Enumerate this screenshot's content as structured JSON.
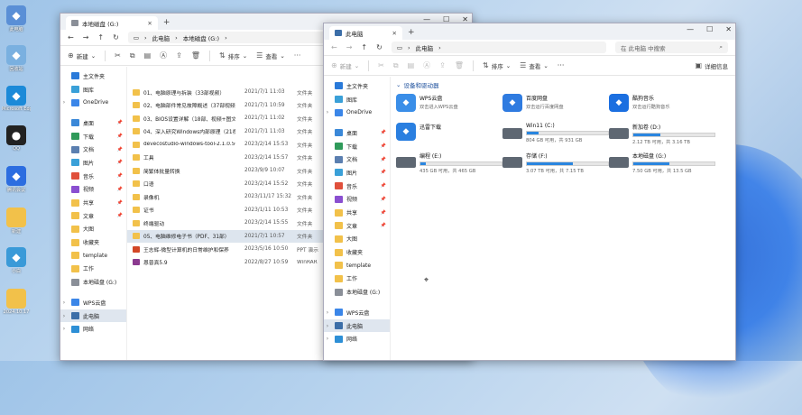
{
  "desktop": {
    "icons": [
      {
        "label": "此电脑",
        "icon": "pc-icon",
        "color": "#5a8fd6"
      },
      {
        "label": "回收站",
        "icon": "recycle-bin-icon",
        "color": "#7ab0e0"
      },
      {
        "label": "Microsoft Edge",
        "icon": "edge-icon",
        "color": "#1c8ad8"
      },
      {
        "label": "QQ",
        "icon": "qq-icon",
        "color": "#222222"
      },
      {
        "label": "腾讯会议",
        "icon": "meeting-icon",
        "color": "#2c6de0"
      },
      {
        "label": "新建",
        "icon": "folder-icon",
        "color": "#f2c14a"
      },
      {
        "label": "小白",
        "icon": "app-icon",
        "color": "#3a9ad8"
      },
      {
        "label": "2024.10.17",
        "icon": "folder-icon",
        "color": "#f2c14a"
      }
    ]
  },
  "left_window": {
    "tab_title": "本地磁盘 (G:)",
    "breadcrumb": [
      "此电脑",
      "本地磁盘 (G:)"
    ],
    "toolbar": {
      "new": "新建",
      "sort": "排序",
      "view": "查看"
    },
    "nav": [
      {
        "label": "主文件夹",
        "icon": "home-icon",
        "chev": "",
        "pin": false,
        "sel": false
      },
      {
        "label": "图库",
        "icon": "gallery-icon",
        "chev": "",
        "pin": false,
        "sel": false
      },
      {
        "label": "OneDrive",
        "icon": "cloud-icon",
        "chev": "›",
        "pin": false,
        "sel": false
      },
      {
        "label": "",
        "icon": "",
        "chev": "",
        "pin": false,
        "sel": false,
        "gap": true
      },
      {
        "label": "桌面",
        "icon": "desktop-icon",
        "chev": "",
        "pin": true,
        "sel": false
      },
      {
        "label": "下载",
        "icon": "download-icon",
        "chev": "",
        "pin": true,
        "sel": false
      },
      {
        "label": "文档",
        "icon": "document-icon",
        "chev": "",
        "pin": true,
        "sel": false
      },
      {
        "label": "图片",
        "icon": "picture-icon",
        "chev": "",
        "pin": true,
        "sel": false
      },
      {
        "label": "音乐",
        "icon": "music-icon",
        "chev": "",
        "pin": true,
        "sel": false
      },
      {
        "label": "视频",
        "icon": "video-icon",
        "chev": "",
        "pin": true,
        "sel": false
      },
      {
        "label": "共享",
        "icon": "folder-icon",
        "chev": "",
        "pin": true,
        "sel": false
      },
      {
        "label": "文章",
        "icon": "folder-icon",
        "chev": "",
        "pin": true,
        "sel": false
      },
      {
        "label": "大图",
        "icon": "folder-icon",
        "chev": "",
        "pin": false,
        "sel": false
      },
      {
        "label": "收藏夹",
        "icon": "folder-icon",
        "chev": "",
        "pin": false,
        "sel": false
      },
      {
        "label": "template",
        "icon": "folder-icon",
        "chev": "",
        "pin": false,
        "sel": false
      },
      {
        "label": "工作",
        "icon": "folder-icon",
        "chev": "",
        "pin": false,
        "sel": false
      },
      {
        "label": "本地磁盘 (G:)",
        "icon": "drive-icon",
        "chev": "",
        "pin": false,
        "sel": false
      },
      {
        "label": "",
        "icon": "",
        "chev": "",
        "pin": false,
        "sel": false,
        "gap": true
      },
      {
        "label": "WPS云盘",
        "icon": "cloud-icon",
        "chev": "›",
        "pin": false,
        "sel": false
      },
      {
        "label": "此电脑",
        "icon": "pc-icon",
        "chev": "›",
        "pin": false,
        "sel": true
      },
      {
        "label": "网络",
        "icon": "network-icon",
        "chev": "›",
        "pin": false,
        "sel": false
      }
    ],
    "files": [
      {
        "name": "01、电脑原理与拆装（33部视频）",
        "date": "2021/7/1 11:03",
        "type": "文件夹",
        "kind": "folder",
        "sel": false
      },
      {
        "name": "02、电脑部件常见故障概述（37部视频）",
        "date": "2021/7/1 10:59",
        "type": "文件夹",
        "kind": "folder",
        "sel": false
      },
      {
        "name": "03、BIOS设置详解（18部、视频+图文）",
        "date": "2021/7/1 11:02",
        "type": "文件夹",
        "kind": "folder",
        "sel": false
      },
      {
        "name": "04、深入研究Windows内部原理（21视...",
        "date": "2021/7/1 11:03",
        "type": "文件夹",
        "kind": "folder",
        "sel": false
      },
      {
        "name": "devecostudio-windows-tool-2.1.0.501",
        "date": "2023/2/14 15:53",
        "type": "文件夹",
        "kind": "folder",
        "sel": false
      },
      {
        "name": "工具",
        "date": "2023/2/14 15:57",
        "type": "文件夹",
        "kind": "folder",
        "sel": false
      },
      {
        "name": "简繁体批量转换",
        "date": "2023/9/9 10:07",
        "type": "文件夹",
        "kind": "folder",
        "sel": false
      },
      {
        "name": "口语",
        "date": "2023/2/14 15:52",
        "type": "文件夹",
        "kind": "folder",
        "sel": false
      },
      {
        "name": "录像机",
        "date": "2023/11/17 15:32",
        "type": "文件夹",
        "kind": "folder",
        "sel": false
      },
      {
        "name": "证书",
        "date": "2023/1/11 10:53",
        "type": "文件夹",
        "kind": "folder",
        "sel": false
      },
      {
        "name": "终端驱动",
        "date": "2023/2/14 15:55",
        "type": "文件夹",
        "kind": "folder",
        "sel": false
      },
      {
        "name": "05、电脑维修电子书（PDF、31部）",
        "date": "2021/7/1 10:57",
        "type": "文件夹",
        "kind": "folder",
        "sel": true
      },
      {
        "name": "王志辉-微型计算机的日常维护和保养",
        "date": "2023/5/16 10:50",
        "type": "PPT 演示",
        "kind": "ppt",
        "sel": false
      },
      {
        "name": "恩普真5.9",
        "date": "2022/8/27 10:59",
        "type": "WinRAR",
        "kind": "rar",
        "sel": false
      }
    ]
  },
  "right_window": {
    "tab_title": "此电脑",
    "breadcrumb": [
      "此电脑"
    ],
    "search_placeholder": "在 此电脑 中搜索",
    "toolbar": {
      "new": "新建",
      "sort": "排序",
      "view": "查看",
      "details": "详细信息"
    },
    "nav": [
      {
        "label": "主文件夹",
        "icon": "home-icon",
        "chev": "",
        "pin": false,
        "sel": false
      },
      {
        "label": "图库",
        "icon": "gallery-icon",
        "chev": "",
        "pin": false,
        "sel": false
      },
      {
        "label": "OneDrive",
        "icon": "cloud-icon",
        "chev": "›",
        "pin": false,
        "sel": false
      },
      {
        "label": "",
        "icon": "",
        "chev": "",
        "pin": false,
        "sel": false,
        "gap": true
      },
      {
        "label": "桌面",
        "icon": "desktop-icon",
        "chev": "",
        "pin": true,
        "sel": false
      },
      {
        "label": "下载",
        "icon": "download-icon",
        "chev": "",
        "pin": true,
        "sel": false
      },
      {
        "label": "文档",
        "icon": "document-icon",
        "chev": "",
        "pin": true,
        "sel": false
      },
      {
        "label": "图片",
        "icon": "picture-icon",
        "chev": "",
        "pin": true,
        "sel": false
      },
      {
        "label": "音乐",
        "icon": "music-icon",
        "chev": "",
        "pin": true,
        "sel": false
      },
      {
        "label": "视频",
        "icon": "video-icon",
        "chev": "",
        "pin": true,
        "sel": false
      },
      {
        "label": "共享",
        "icon": "folder-icon",
        "chev": "",
        "pin": true,
        "sel": false
      },
      {
        "label": "文章",
        "icon": "folder-icon",
        "chev": "",
        "pin": true,
        "sel": false
      },
      {
        "label": "大图",
        "icon": "folder-icon",
        "chev": "",
        "pin": false,
        "sel": false
      },
      {
        "label": "收藏夹",
        "icon": "folder-icon",
        "chev": "",
        "pin": false,
        "sel": false
      },
      {
        "label": "template",
        "icon": "folder-icon",
        "chev": "",
        "pin": false,
        "sel": false
      },
      {
        "label": "工作",
        "icon": "folder-icon",
        "chev": "",
        "pin": false,
        "sel": false
      },
      {
        "label": "本地磁盘 (G:)",
        "icon": "drive-icon",
        "chev": "",
        "pin": false,
        "sel": false
      },
      {
        "label": "",
        "icon": "",
        "chev": "",
        "pin": false,
        "sel": false,
        "gap": true
      },
      {
        "label": "WPS云盘",
        "icon": "cloud-icon",
        "chev": "›",
        "pin": false,
        "sel": false
      },
      {
        "label": "此电脑",
        "icon": "pc-icon",
        "chev": "›",
        "pin": false,
        "sel": true
      },
      {
        "label": "网络",
        "icon": "network-icon",
        "chev": "›",
        "pin": false,
        "sel": false
      }
    ],
    "group_title": "设备和驱动器",
    "drives": [
      {
        "name": "WPS云盘",
        "sub": "双击进入WPS云盘",
        "icon": "wps-cloud-icon",
        "color": "#3a8ee8",
        "used_fraction": null
      },
      {
        "name": "百度网盘",
        "sub": "双击运行百度网盘",
        "icon": "baidu-netdisk-icon",
        "color": "#2f7be0",
        "used_fraction": null
      },
      {
        "name": "酷狗音乐",
        "sub": "双击运行酷狗音乐",
        "icon": "kugou-icon",
        "color": "#1b6fe0",
        "used_fraction": null
      },
      {
        "name": "迅雷下载",
        "sub": "",
        "icon": "xunlei-icon",
        "color": "#2a7fe0",
        "used_fraction": null
      },
      {
        "name": "Win11 (C:)",
        "sub": "804 GB 可用，共 931 GB",
        "icon": "windows-drive-icon",
        "color": "#5e6772",
        "used_fraction": 0.14
      },
      {
        "name": "新加卷 (D:)",
        "sub": "2.12 TB 可用，共 3.16 TB",
        "icon": "drive-icon",
        "color": "#5e6772",
        "used_fraction": 0.33
      },
      {
        "name": "编程 (E:)",
        "sub": "435 GB 可用，共 465 GB",
        "icon": "drive-icon",
        "color": "#5e6772",
        "used_fraction": 0.07
      },
      {
        "name": "存储 (F:)",
        "sub": "3.07 TB 可用，共 7.15 TB",
        "icon": "drive-icon",
        "color": "#5e6772",
        "used_fraction": 0.57
      },
      {
        "name": "本地磁盘 (G:)",
        "sub": "7.50 GB 可用，共 13.5 GB",
        "icon": "drive-icon",
        "color": "#5e6772",
        "used_fraction": 0.44
      }
    ]
  }
}
